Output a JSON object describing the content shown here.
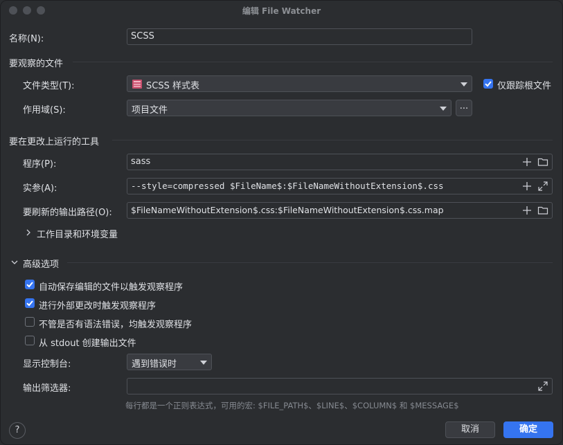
{
  "window": {
    "title": "编辑 File Watcher"
  },
  "name": {
    "label": "名称(N):",
    "value": "SCSS"
  },
  "files_section": {
    "title": "要观察的文件",
    "file_type_label": "文件类型(T):",
    "file_type_value": "SCSS 样式表",
    "track_root_label": "仅跟踪根文件",
    "scope_label": "作用域(S):",
    "scope_value": "项目文件",
    "scope_more": "..."
  },
  "tool_section": {
    "title": "要在更改上运行的工具",
    "program_label": "程序(P):",
    "program_value": "sass",
    "args_label": "实参(A):",
    "args_value": "--style=compressed $FileName$:$FileNameWithoutExtension$.css",
    "output_label": "要刷新的输出路径(O):",
    "output_value": "$FileNameWithoutExtension$.css:$FileNameWithoutExtension$.css.map",
    "workdir_label": "工作目录和环境变量"
  },
  "advanced": {
    "title": "高级选项",
    "options": [
      {
        "label": "自动保存编辑的文件以触发观察程序",
        "checked": true
      },
      {
        "label": "进行外部更改时触发观察程序",
        "checked": true
      },
      {
        "label": "不管是否有语法错误，均触发观察程序",
        "checked": false
      },
      {
        "label": "从 stdout 创建输出文件",
        "checked": false
      }
    ],
    "console_label": "显示控制台:",
    "console_value": "遇到错误时",
    "filter_label": "输出筛选器:",
    "filter_value": "",
    "filter_hint": "每行都是一个正则表达式，可用的宏: $FILE_PATH$、$LINE$、$COLUMN$ 和 $MESSAGE$"
  },
  "footer": {
    "help": "?",
    "cancel_label": "取消",
    "ok_label": "确定"
  },
  "colors": {
    "accent": "#3574f0",
    "background": "#2b2d30",
    "border": "#4e5157"
  },
  "icons": [
    "scss-file-icon",
    "plus-icon",
    "folder-icon",
    "expand-icon",
    "chevron-right-icon",
    "chevron-down-icon",
    "help-icon",
    "dropdown-arrow-icon"
  ]
}
